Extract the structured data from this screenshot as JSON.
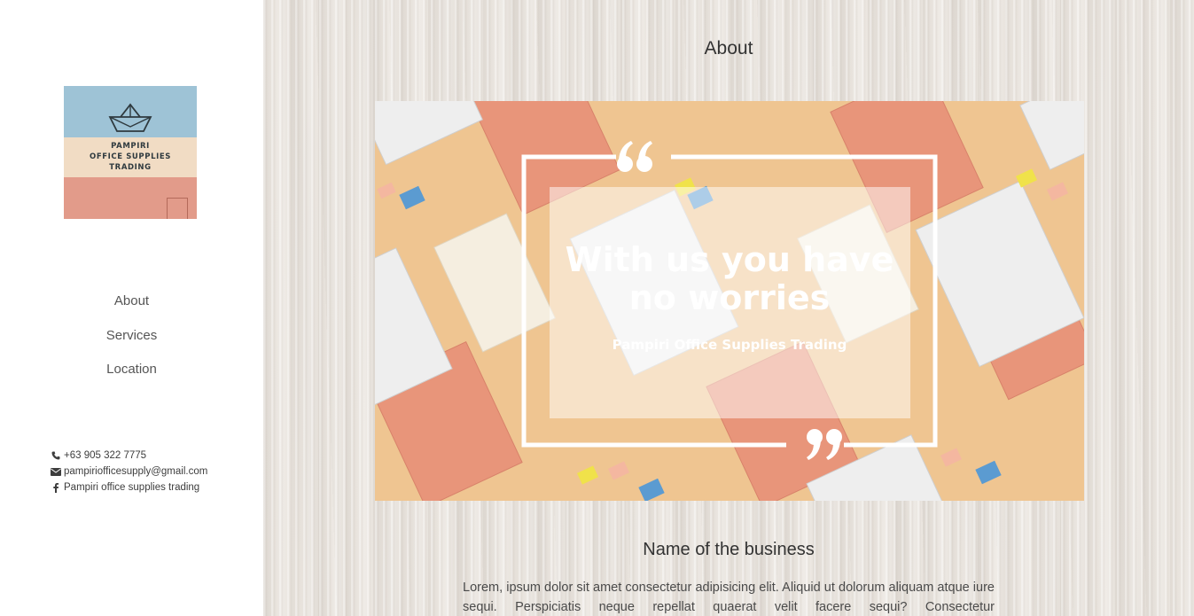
{
  "sidebar": {
    "logo": {
      "lines": [
        "PAMPIRI",
        "OFFICE SUPPLIES",
        "TRADING"
      ]
    },
    "nav": [
      {
        "label": "About"
      },
      {
        "label": "Services"
      },
      {
        "label": "Location"
      }
    ],
    "contact": {
      "phone": "+63 905 322 7775",
      "email": "pampiriofficesupply@gmail.com",
      "facebook": "Pampiri office supplies trading"
    }
  },
  "main": {
    "title": "About",
    "banner": {
      "headline_line1": "With us you have",
      "headline_line2": "no worries",
      "subline": "Pampiri Office Supplies Trading"
    },
    "business_name": "Name of the business",
    "paragraph": "Lorem, ipsum dolor sit amet consectetur adipisicing elit. Aliquid ut dolorum aliquam atque iure sequi. Perspiciatis neque repellat quaerat velit facere sequi? Consectetur"
  },
  "colors": {
    "sidebar_bg": "#ffffff",
    "banner_bg": "#efc591",
    "accent_orange": "#e8957a",
    "text_dark": "#333333"
  },
  "icons": {
    "phone": "phone-icon",
    "email": "envelope-icon",
    "facebook": "facebook-icon",
    "logo_ship": "paper-boat-icon",
    "quote_open": "quote-open-icon",
    "quote_close": "quote-close-icon"
  }
}
